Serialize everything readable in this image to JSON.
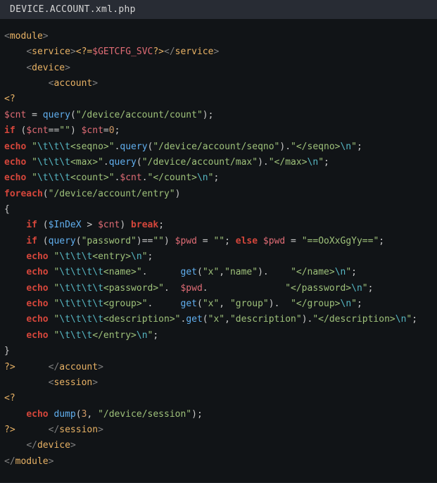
{
  "title": "DEVICE.ACCOUNT.xml.php",
  "lines": {
    "l1": [
      {
        "c": "angle",
        "t": "<"
      },
      {
        "c": "tag",
        "t": "module"
      },
      {
        "c": "angle",
        "t": ">"
      }
    ],
    "l2": [
      {
        "c": "punct",
        "t": "    "
      },
      {
        "c": "angle",
        "t": "<"
      },
      {
        "c": "tag",
        "t": "service"
      },
      {
        "c": "angle",
        "t": ">"
      },
      {
        "c": "tag",
        "t": "<?="
      },
      {
        "c": "var",
        "t": "$GETCFG_SVC"
      },
      {
        "c": "tag",
        "t": "?>"
      },
      {
        "c": "angle",
        "t": "</"
      },
      {
        "c": "tag",
        "t": "service"
      },
      {
        "c": "angle",
        "t": ">"
      }
    ],
    "l3": [
      {
        "c": "punct",
        "t": "    "
      },
      {
        "c": "angle",
        "t": "<"
      },
      {
        "c": "tag",
        "t": "device"
      },
      {
        "c": "angle",
        "t": ">"
      }
    ],
    "l4": [
      {
        "c": "punct",
        "t": "        "
      },
      {
        "c": "angle",
        "t": "<"
      },
      {
        "c": "tag",
        "t": "account"
      },
      {
        "c": "angle",
        "t": ">"
      }
    ],
    "l5": [
      {
        "c": "tag",
        "t": "<?"
      }
    ],
    "l6": [
      {
        "c": "var",
        "t": "$cnt"
      },
      {
        "c": "punct",
        "t": " = "
      },
      {
        "c": "func",
        "t": "query"
      },
      {
        "c": "punct",
        "t": "("
      },
      {
        "c": "str",
        "t": "\"/device/account/count\""
      },
      {
        "c": "punct",
        "t": ");"
      }
    ],
    "l7": [
      {
        "c": "kw",
        "t": "if"
      },
      {
        "c": "punct",
        "t": " ("
      },
      {
        "c": "var",
        "t": "$cnt"
      },
      {
        "c": "punct",
        "t": "=="
      },
      {
        "c": "str",
        "t": "\"\""
      },
      {
        "c": "punct",
        "t": ") "
      },
      {
        "c": "var",
        "t": "$cnt"
      },
      {
        "c": "punct",
        "t": "="
      },
      {
        "c": "num",
        "t": "0"
      },
      {
        "c": "punct",
        "t": ";"
      }
    ],
    "l8": [
      {
        "c": "echo",
        "t": "echo"
      },
      {
        "c": "punct",
        "t": " "
      },
      {
        "c": "str",
        "t": "\""
      },
      {
        "c": "esc",
        "t": "\\t\\t\\t"
      },
      {
        "c": "str",
        "t": "<seqno>\""
      },
      {
        "c": "punct",
        "t": "."
      },
      {
        "c": "func",
        "t": "query"
      },
      {
        "c": "punct",
        "t": "("
      },
      {
        "c": "str",
        "t": "\"/device/account/seqno\""
      },
      {
        "c": "punct",
        "t": ")."
      },
      {
        "c": "str",
        "t": "\"</seqno>"
      },
      {
        "c": "esc",
        "t": "\\n"
      },
      {
        "c": "str",
        "t": "\""
      },
      {
        "c": "punct",
        "t": ";"
      }
    ],
    "l9": [
      {
        "c": "echo",
        "t": "echo"
      },
      {
        "c": "punct",
        "t": " "
      },
      {
        "c": "str",
        "t": "\""
      },
      {
        "c": "esc",
        "t": "\\t\\t\\t"
      },
      {
        "c": "str",
        "t": "<max>\""
      },
      {
        "c": "punct",
        "t": "."
      },
      {
        "c": "func",
        "t": "query"
      },
      {
        "c": "punct",
        "t": "("
      },
      {
        "c": "str",
        "t": "\"/device/account/max\""
      },
      {
        "c": "punct",
        "t": ")."
      },
      {
        "c": "str",
        "t": "\"</max>"
      },
      {
        "c": "esc",
        "t": "\\n"
      },
      {
        "c": "str",
        "t": "\""
      },
      {
        "c": "punct",
        "t": ";"
      }
    ],
    "l10": [
      {
        "c": "echo",
        "t": "echo"
      },
      {
        "c": "punct",
        "t": " "
      },
      {
        "c": "str",
        "t": "\""
      },
      {
        "c": "esc",
        "t": "\\t\\t\\t"
      },
      {
        "c": "str",
        "t": "<count>\""
      },
      {
        "c": "punct",
        "t": "."
      },
      {
        "c": "var",
        "t": "$cnt"
      },
      {
        "c": "punct",
        "t": "."
      },
      {
        "c": "str",
        "t": "\"</count>"
      },
      {
        "c": "esc",
        "t": "\\n"
      },
      {
        "c": "str",
        "t": "\""
      },
      {
        "c": "punct",
        "t": ";"
      }
    ],
    "l11": [
      {
        "c": "kw",
        "t": "foreach"
      },
      {
        "c": "punct",
        "t": "("
      },
      {
        "c": "str",
        "t": "\"/device/account/entry\""
      },
      {
        "c": "punct",
        "t": ")"
      }
    ],
    "l12": [
      {
        "c": "punct",
        "t": "{"
      }
    ],
    "l13": [
      {
        "c": "punct",
        "t": "    "
      },
      {
        "c": "kw",
        "t": "if"
      },
      {
        "c": "punct",
        "t": " ("
      },
      {
        "c": "func",
        "t": "$InDeX"
      },
      {
        "c": "punct",
        "t": " > "
      },
      {
        "c": "var",
        "t": "$cnt"
      },
      {
        "c": "punct",
        "t": ") "
      },
      {
        "c": "kw",
        "t": "break"
      },
      {
        "c": "punct",
        "t": ";"
      }
    ],
    "l14": [
      {
        "c": "punct",
        "t": "    "
      },
      {
        "c": "kw",
        "t": "if"
      },
      {
        "c": "punct",
        "t": " ("
      },
      {
        "c": "func",
        "t": "query"
      },
      {
        "c": "punct",
        "t": "("
      },
      {
        "c": "str",
        "t": "\"password\""
      },
      {
        "c": "punct",
        "t": ")=="
      },
      {
        "c": "str",
        "t": "\"\""
      },
      {
        "c": "punct",
        "t": ") "
      },
      {
        "c": "var",
        "t": "$pwd"
      },
      {
        "c": "punct",
        "t": " = "
      },
      {
        "c": "str",
        "t": "\"\""
      },
      {
        "c": "punct",
        "t": "; "
      },
      {
        "c": "kw",
        "t": "else"
      },
      {
        "c": "punct",
        "t": " "
      },
      {
        "c": "var",
        "t": "$pwd"
      },
      {
        "c": "punct",
        "t": " = "
      },
      {
        "c": "str",
        "t": "\"==OoXxGgYy==\""
      },
      {
        "c": "punct",
        "t": ";"
      }
    ],
    "l15": [
      {
        "c": "punct",
        "t": "    "
      },
      {
        "c": "echo",
        "t": "echo"
      },
      {
        "c": "punct",
        "t": " "
      },
      {
        "c": "str",
        "t": "\""
      },
      {
        "c": "esc",
        "t": "\\t\\t\\t"
      },
      {
        "c": "str",
        "t": "<entry>"
      },
      {
        "c": "esc",
        "t": "\\n"
      },
      {
        "c": "str",
        "t": "\""
      },
      {
        "c": "punct",
        "t": ";"
      }
    ],
    "l16": [
      {
        "c": "punct",
        "t": "    "
      },
      {
        "c": "echo",
        "t": "echo"
      },
      {
        "c": "punct",
        "t": " "
      },
      {
        "c": "str",
        "t": "\""
      },
      {
        "c": "esc",
        "t": "\\t\\t\\t\\t"
      },
      {
        "c": "str",
        "t": "<name>\""
      },
      {
        "c": "punct",
        "t": ".      "
      },
      {
        "c": "func",
        "t": "get"
      },
      {
        "c": "punct",
        "t": "("
      },
      {
        "c": "str",
        "t": "\"x\""
      },
      {
        "c": "punct",
        "t": ","
      },
      {
        "c": "str",
        "t": "\"name\""
      },
      {
        "c": "punct",
        "t": ").    "
      },
      {
        "c": "str",
        "t": "\"</name>"
      },
      {
        "c": "esc",
        "t": "\\n"
      },
      {
        "c": "str",
        "t": "\""
      },
      {
        "c": "punct",
        "t": ";"
      }
    ],
    "l17": [
      {
        "c": "punct",
        "t": "    "
      },
      {
        "c": "echo",
        "t": "echo"
      },
      {
        "c": "punct",
        "t": " "
      },
      {
        "c": "str",
        "t": "\""
      },
      {
        "c": "esc",
        "t": "\\t\\t\\t\\t"
      },
      {
        "c": "str",
        "t": "<password>\""
      },
      {
        "c": "punct",
        "t": ".  "
      },
      {
        "c": "var",
        "t": "$pwd"
      },
      {
        "c": "punct",
        "t": ".              "
      },
      {
        "c": "str",
        "t": "\"</password>"
      },
      {
        "c": "esc",
        "t": "\\n"
      },
      {
        "c": "str",
        "t": "\""
      },
      {
        "c": "punct",
        "t": ";"
      }
    ],
    "l18": [
      {
        "c": "punct",
        "t": "    "
      },
      {
        "c": "echo",
        "t": "echo"
      },
      {
        "c": "punct",
        "t": " "
      },
      {
        "c": "str",
        "t": "\""
      },
      {
        "c": "esc",
        "t": "\\t\\t\\t\\t"
      },
      {
        "c": "str",
        "t": "<group>\""
      },
      {
        "c": "punct",
        "t": ".     "
      },
      {
        "c": "func",
        "t": "get"
      },
      {
        "c": "punct",
        "t": "("
      },
      {
        "c": "str",
        "t": "\"x\""
      },
      {
        "c": "punct",
        "t": ", "
      },
      {
        "c": "str",
        "t": "\"group\""
      },
      {
        "c": "punct",
        "t": ").  "
      },
      {
        "c": "str",
        "t": "\"</group>"
      },
      {
        "c": "esc",
        "t": "\\n"
      },
      {
        "c": "str",
        "t": "\""
      },
      {
        "c": "punct",
        "t": ";"
      }
    ],
    "l19": [
      {
        "c": "punct",
        "t": "    "
      },
      {
        "c": "echo",
        "t": "echo"
      },
      {
        "c": "punct",
        "t": " "
      },
      {
        "c": "str",
        "t": "\""
      },
      {
        "c": "esc",
        "t": "\\t\\t\\t\\t"
      },
      {
        "c": "str",
        "t": "<description>\""
      },
      {
        "c": "punct",
        "t": "."
      },
      {
        "c": "func",
        "t": "get"
      },
      {
        "c": "punct",
        "t": "("
      },
      {
        "c": "str",
        "t": "\"x\""
      },
      {
        "c": "punct",
        "t": ","
      },
      {
        "c": "str",
        "t": "\"description\""
      },
      {
        "c": "punct",
        "t": ")."
      },
      {
        "c": "str",
        "t": "\"</description>"
      },
      {
        "c": "esc",
        "t": "\\n"
      },
      {
        "c": "str",
        "t": "\""
      },
      {
        "c": "punct",
        "t": ";"
      }
    ],
    "l20": [
      {
        "c": "punct",
        "t": "    "
      },
      {
        "c": "echo",
        "t": "echo"
      },
      {
        "c": "punct",
        "t": " "
      },
      {
        "c": "str",
        "t": "\""
      },
      {
        "c": "esc",
        "t": "\\t\\t\\t"
      },
      {
        "c": "str",
        "t": "</entry>"
      },
      {
        "c": "esc",
        "t": "\\n"
      },
      {
        "c": "str",
        "t": "\""
      },
      {
        "c": "punct",
        "t": ";"
      }
    ],
    "l21": [
      {
        "c": "punct",
        "t": "}"
      }
    ],
    "l22": [
      {
        "c": "tag",
        "t": "?>"
      },
      {
        "c": "punct",
        "t": "      "
      },
      {
        "c": "angle",
        "t": "</"
      },
      {
        "c": "tag",
        "t": "account"
      },
      {
        "c": "angle",
        "t": ">"
      }
    ],
    "l23": [
      {
        "c": "punct",
        "t": "        "
      },
      {
        "c": "angle",
        "t": "<"
      },
      {
        "c": "tag",
        "t": "session"
      },
      {
        "c": "angle",
        "t": ">"
      }
    ],
    "l24": [
      {
        "c": "tag",
        "t": "<?"
      }
    ],
    "l25": [
      {
        "c": "punct",
        "t": "    "
      },
      {
        "c": "echo",
        "t": "echo"
      },
      {
        "c": "punct",
        "t": " "
      },
      {
        "c": "func",
        "t": "dump"
      },
      {
        "c": "punct",
        "t": "("
      },
      {
        "c": "num",
        "t": "3"
      },
      {
        "c": "punct",
        "t": ", "
      },
      {
        "c": "str",
        "t": "\"/device/session\""
      },
      {
        "c": "punct",
        "t": ");"
      }
    ],
    "l26": [
      {
        "c": "tag",
        "t": "?>"
      },
      {
        "c": "punct",
        "t": "      "
      },
      {
        "c": "angle",
        "t": "</"
      },
      {
        "c": "tag",
        "t": "session"
      },
      {
        "c": "angle",
        "t": ">"
      }
    ],
    "l27": [
      {
        "c": "punct",
        "t": "    "
      },
      {
        "c": "angle",
        "t": "</"
      },
      {
        "c": "tag",
        "t": "device"
      },
      {
        "c": "angle",
        "t": ">"
      }
    ],
    "l28": [
      {
        "c": "angle",
        "t": "</"
      },
      {
        "c": "tag",
        "t": "module"
      },
      {
        "c": "angle",
        "t": ">"
      }
    ]
  }
}
